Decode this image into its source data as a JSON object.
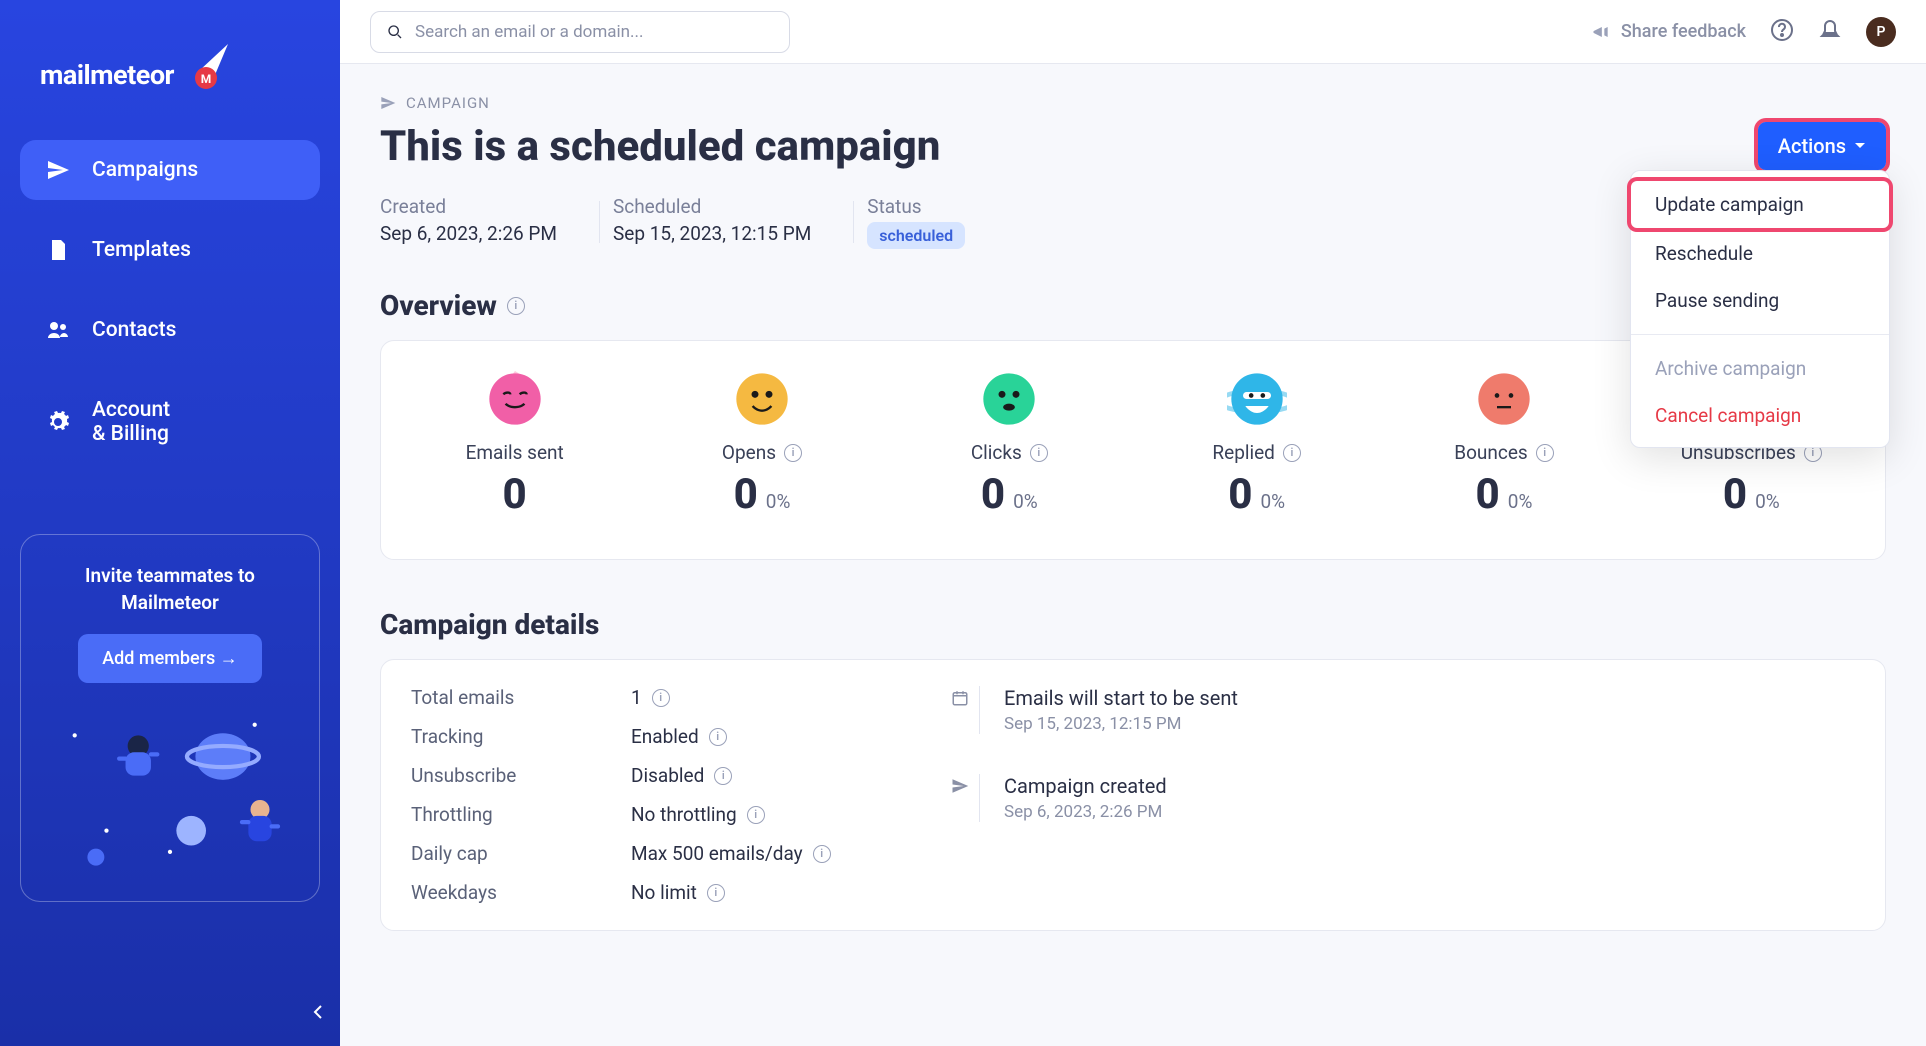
{
  "brand": "mailmeteor",
  "search": {
    "placeholder": "Search an email or a domain..."
  },
  "topbar": {
    "feedback": "Share feedback",
    "avatar_initial": "P"
  },
  "sidebar": {
    "items": [
      {
        "label": "Campaigns",
        "active": true
      },
      {
        "label": "Templates"
      },
      {
        "label": "Contacts"
      },
      {
        "label": "Account\n& Billing"
      }
    ],
    "invite": {
      "title": "Invite teammates to Mailmeteor",
      "button": "Add members →"
    }
  },
  "breadcrumb": "CAMPAIGN",
  "title": "This is a scheduled campaign",
  "meta": {
    "created_label": "Created",
    "created_value": "Sep 6, 2023, 2:26 PM",
    "scheduled_label": "Scheduled",
    "scheduled_value": "Sep 15, 2023, 12:15 PM",
    "status_label": "Status",
    "status_value": "scheduled"
  },
  "actions": {
    "button": "Actions",
    "items": {
      "update": "Update campaign",
      "reschedule": "Reschedule",
      "pause": "Pause sending",
      "archive": "Archive campaign",
      "cancel": "Cancel campaign"
    }
  },
  "overview": {
    "heading": "Overview",
    "stats": [
      {
        "label": "Emails sent",
        "value": "0",
        "pct": ""
      },
      {
        "label": "Opens",
        "value": "0",
        "pct": "0%"
      },
      {
        "label": "Clicks",
        "value": "0",
        "pct": "0%"
      },
      {
        "label": "Replied",
        "value": "0",
        "pct": "0%"
      },
      {
        "label": "Bounces",
        "value": "0",
        "pct": "0%"
      },
      {
        "label": "Unsubscribes",
        "value": "0",
        "pct": "0%"
      }
    ]
  },
  "details": {
    "heading": "Campaign details",
    "rows": [
      {
        "label": "Total emails",
        "value": "1"
      },
      {
        "label": "Tracking",
        "value": "Enabled"
      },
      {
        "label": "Unsubscribe",
        "value": "Disabled"
      },
      {
        "label": "Throttling",
        "value": "No throttling"
      },
      {
        "label": "Daily cap",
        "value": "Max 500 emails/day"
      },
      {
        "label": "Weekdays",
        "value": "No limit"
      }
    ],
    "timeline": [
      {
        "title": "Emails will start to be sent",
        "time": "Sep 15, 2023, 12:15 PM",
        "icon": "calendar"
      },
      {
        "title": "Campaign created",
        "time": "Sep 6, 2023, 2:26 PM",
        "icon": "send"
      }
    ]
  },
  "stat_colors": [
    "#f15fa7",
    "#f5b941",
    "#29d398",
    "#2fb6e8",
    "#ef7b6c",
    "#e8bcc3"
  ]
}
